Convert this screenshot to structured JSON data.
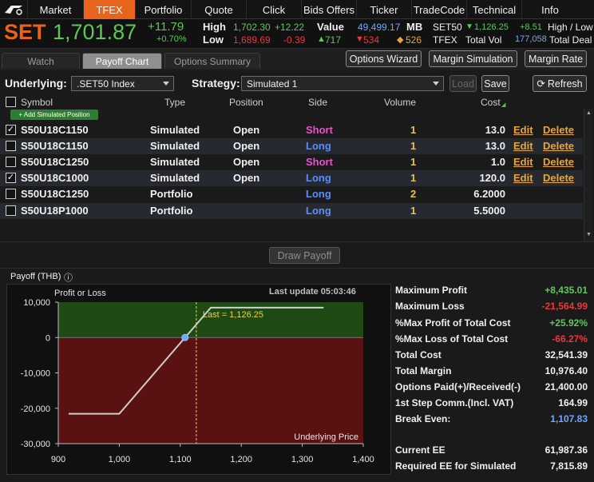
{
  "nav": {
    "tabs": [
      "Market",
      "TFEX",
      "Portfolio",
      "Quote",
      "Click",
      "Bids Offers",
      "Ticker",
      "TradeCode",
      "Technical",
      "Info"
    ],
    "active": "TFEX"
  },
  "ticker": {
    "symbol": "SET",
    "price": "1,701.87",
    "change": "+11.79",
    "change_pct": "+0.70%",
    "high_label": "High",
    "high_value": "1,702.30",
    "high_change": "+12.22",
    "low_label": "Low",
    "low_value": "1,689.69",
    "low_change": "-0.39",
    "value_label": "Value",
    "value_amount": "49,499.17",
    "value_unit": "MB",
    "adv": "717",
    "dec": "534",
    "unch": "526",
    "set50_label": "SET50",
    "set50_change_arrow": "▼",
    "set50_value": "1,126.25",
    "set50_change": "+8.51",
    "hl_label": "High / Low",
    "tfex_label": "TFEX",
    "total_vol_label": "Total Vol",
    "total_vol": "177,058",
    "total_deal_label": "Total Deal"
  },
  "subtabs": [
    "Watch",
    "Payoff Chart",
    "Options Summary"
  ],
  "active_subtab": "Payoff Chart",
  "buttons": {
    "options_wizard": "Options Wizard",
    "margin_simulation": "Margin Simulation",
    "margin_rate": "Margin Rate",
    "load": "Load",
    "save": "Save",
    "refresh": "Refresh",
    "draw_payoff": "Draw Payoff",
    "add_position": "+ Add Simulated Position"
  },
  "underlying": {
    "label": "Underlying:",
    "value": ".SET50 Index"
  },
  "strategy": {
    "label": "Strategy:",
    "value": "Simulated 1"
  },
  "table": {
    "headers": [
      "Symbol",
      "Type",
      "Position",
      "Side",
      "Volume",
      "Cost"
    ],
    "rows": [
      {
        "checked": true,
        "symbol": "S50U18C1150",
        "type": "Simulated",
        "position": "Open",
        "side": "Short",
        "volume": "1",
        "cost": "13.0",
        "edit": "Edit",
        "delete": "Delete"
      },
      {
        "checked": false,
        "symbol": "S50U18C1150",
        "type": "Simulated",
        "position": "Open",
        "side": "Long",
        "volume": "1",
        "cost": "13.0",
        "edit": "Edit",
        "delete": "Delete"
      },
      {
        "checked": false,
        "symbol": "S50U18C1250",
        "type": "Simulated",
        "position": "Open",
        "side": "Short",
        "volume": "1",
        "cost": "1.0",
        "edit": "Edit",
        "delete": "Delete"
      },
      {
        "checked": true,
        "symbol": "S50U18C1000",
        "type": "Simulated",
        "position": "Open",
        "side": "Long",
        "volume": "1",
        "cost": "120.0",
        "edit": "Edit",
        "delete": "Delete"
      },
      {
        "checked": false,
        "symbol": "S50U18C1250",
        "type": "Portfolio",
        "position": "",
        "side": "Long",
        "volume": "2",
        "cost": "6.2000",
        "edit": "",
        "delete": ""
      },
      {
        "checked": false,
        "symbol": "S50U18P1000",
        "type": "Portfolio",
        "position": "",
        "side": "Long",
        "volume": "1",
        "cost": "5.5000",
        "edit": "",
        "delete": ""
      }
    ]
  },
  "payoff": {
    "title": "Payoff (THB)",
    "info_icon": "info-icon",
    "last_update": "Last update 05:03:46"
  },
  "chart_data": {
    "type": "line",
    "ylabel": "Profit or Loss",
    "xlabel": "Underlying Price",
    "xlim": [
      900,
      1400
    ],
    "ylim": [
      -30000,
      10000
    ],
    "x_ticks": [
      "900",
      "1,000",
      "1,100",
      "1,200",
      "1,300",
      "1,400"
    ],
    "y_ticks": [
      "10,000",
      "0",
      "-10,000",
      "-20,000",
      "-30,000"
    ],
    "x": [
      917,
      1000,
      1150,
      1335
    ],
    "y": [
      -21565,
      -21565,
      8435,
      8435
    ],
    "last_line_x": 1126.25,
    "last_label": "Last = 1,126.25",
    "break_even_x": 1107.83,
    "profit_color": "#1f4a14",
    "loss_color": "#5a1111",
    "line_color": "#cfcfcf"
  },
  "summary": [
    {
      "label": "Maximum Profit",
      "value": "+8,435.01",
      "color": "green"
    },
    {
      "label": "Maximum Loss",
      "value": "-21,564.99",
      "color": "red"
    },
    {
      "label": "%Max Profit of Total Cost",
      "value": "+25.92%",
      "color": "green"
    },
    {
      "label": "%Max Loss of Total Cost",
      "value": "-66.27%",
      "color": "red"
    },
    {
      "label": "Total Cost",
      "value": "32,541.39",
      "color": "white"
    },
    {
      "label": "Total Margin",
      "value": "10,976.40",
      "color": "white"
    },
    {
      "label": "Options Paid(+)/Received(-)",
      "value": "21,400.00",
      "color": "white"
    },
    {
      "label": "1st Step Comm.(Incl. VAT)",
      "value": "164.99",
      "color": "white"
    },
    {
      "label": "Break Even:",
      "value": "1,107.83",
      "color": "blue"
    },
    {
      "label": "Current EE",
      "value": "61,987.36",
      "color": "white"
    },
    {
      "label": "Required EE for Simulated",
      "value": "7,815.89",
      "color": "white"
    }
  ]
}
